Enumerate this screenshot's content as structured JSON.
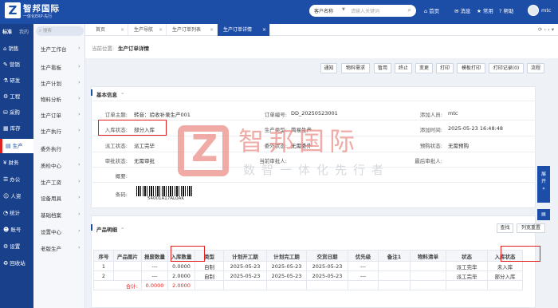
{
  "header": {
    "logo_letter": "Z",
    "brand": "智邦国际",
    "slogan": "一体化ERP·先行",
    "search": {
      "select": "客户名称",
      "placeholder": "请输入关键词"
    },
    "nav": [
      "首页",
      "消息",
      "常用",
      "帮助"
    ],
    "user": "mtc"
  },
  "nav1": {
    "tabs": [
      "标准",
      "我的"
    ],
    "items": [
      "销售",
      "营销",
      "研发",
      "工程",
      "采购",
      "库存",
      "生产",
      "财务",
      "办公",
      "人资",
      "统计",
      "账号",
      "设置",
      "回收站"
    ],
    "active": "生产"
  },
  "nav2": {
    "search_placeholder": "搜索",
    "items": [
      "生产工作台",
      "生产看板",
      "生产计划",
      "物料分析",
      "生产订单",
      "生产执行",
      "委外执行",
      "质检中心",
      "生产工资",
      "设备用具",
      "基础档案",
      "设置中心",
      "老版生产"
    ]
  },
  "tabs": [
    {
      "label": "首页",
      "active": false
    },
    {
      "label": "生产导航",
      "active": false
    },
    {
      "label": "生产订单列表",
      "active": false
    },
    {
      "label": "生产订单详情",
      "active": true
    }
  ],
  "tab_tools": "⟳ ‹ › ▾",
  "breadcrumb": {
    "label": "当前位置:",
    "page": "生产订单详情"
  },
  "toolbar": [
    "通知",
    "物料需求",
    "暂用",
    "终止",
    "变更",
    "打印",
    "模板打印",
    "打印记录(0)",
    "流程"
  ],
  "basic": {
    "title": "基本信息",
    "collapse": "⌃",
    "fields": {
      "subject": {
        "label": "订单主题:",
        "value": "转音：验收补录生产001"
      },
      "order_no": {
        "label": "订单编号:",
        "value": "DD_20250523001"
      },
      "creator": {
        "label": "添加人员:",
        "value": "mtc"
      },
      "stock_status": {
        "label": "入库状态:",
        "value": "部分入库"
      },
      "prod_type": {
        "label": "生产类型:",
        "value": "简易生产"
      },
      "created": {
        "label": "添加时间:",
        "value": "2025-05-23 16:48:48"
      },
      "dispatch": {
        "label": "派工状态:",
        "value": "派工完毕"
      },
      "outsource": {
        "label": "委外状态:",
        "value": "无需委外"
      },
      "plan": {
        "label": "预购状态:",
        "value": "无需预购"
      },
      "audit": {
        "label": "审批状态:",
        "value": "无需审批"
      },
      "approver": {
        "label": "当前审批人:",
        "value": ""
      },
      "last_approver": {
        "label": "最后审批人:",
        "value": ""
      },
      "summary": {
        "label": "概要:",
        "value": ""
      },
      "barcode": {
        "label": "条码:",
        "value": "54001A17AL0AK"
      }
    }
  },
  "products": {
    "title": "产品明细",
    "collapse": "⌃",
    "buttons": [
      "查找",
      "列宽重置"
    ],
    "columns": [
      "序号",
      "产品图片",
      "报废数量",
      "入库数量",
      "类型",
      "计划开工期",
      "计划完工期",
      "交货日期",
      "优先级",
      "备注1",
      "物料清单",
      "状态",
      "入库状态"
    ],
    "rows": [
      [
        "1",
        "",
        "---",
        "0.0000",
        "自制",
        "2025-05-23",
        "2025-05-23",
        "2025-05-23",
        "---",
        "",
        "",
        "派工完毕",
        "未入库"
      ],
      [
        "2",
        "",
        "---",
        "2.0000",
        "自制",
        "2025-05-23",
        "2025-05-23",
        "2025-05-23",
        "---",
        "",
        "",
        "派工完毕",
        "部分入库"
      ]
    ],
    "total": {
      "label": "合计:",
      "scrap": "0.0000",
      "stock": "2.0000"
    }
  },
  "watermark": {
    "letter": "Z",
    "big": "智邦国际",
    "small": "数智一体化先行者"
  },
  "float": {
    "expand": "展开",
    "arrow": "«",
    "chat": "▤"
  }
}
